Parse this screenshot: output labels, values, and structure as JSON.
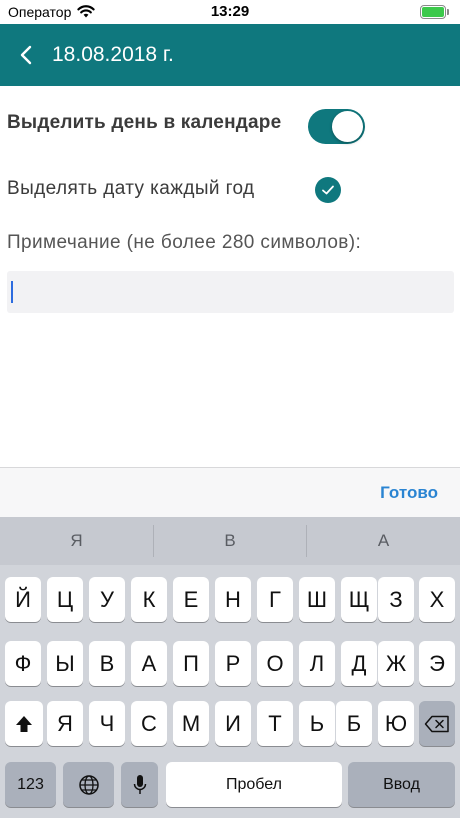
{
  "status_bar": {
    "carrier": "Оператор",
    "time": "13:29"
  },
  "nav": {
    "title": "18.08.2018 г."
  },
  "settings": {
    "highlight_day_label": "Выделить день в календаре",
    "highlight_day_on": true,
    "yearly_label": "Выделять дату каждый год",
    "yearly_checked": true,
    "note_label": "Примечание (не более 280 символов):",
    "note_value": ""
  },
  "accessory": {
    "done_label": "Готово"
  },
  "keyboard": {
    "suggestions": [
      "Я",
      "В",
      "А"
    ],
    "row1": [
      "Й",
      "Ц",
      "У",
      "К",
      "Е",
      "Н",
      "Г",
      "Ш",
      "Щ",
      "З",
      "Х"
    ],
    "row2": [
      "Ф",
      "Ы",
      "В",
      "А",
      "П",
      "Р",
      "О",
      "Л",
      "Д",
      "Ж",
      "Э"
    ],
    "row3": [
      "Я",
      "Ч",
      "С",
      "М",
      "И",
      "Т",
      "Ь",
      "Б",
      "Ю"
    ],
    "numbers_label": "123",
    "space_label": "Пробел",
    "return_label": "Ввод"
  },
  "colors": {
    "accent": "#0f787e",
    "done": "#2a84d2"
  },
  "icons": [
    "wifi-icon",
    "battery-icon",
    "back-chevron-icon",
    "checkmark-icon",
    "shift-icon",
    "backspace-icon",
    "globe-icon",
    "microphone-icon"
  ]
}
